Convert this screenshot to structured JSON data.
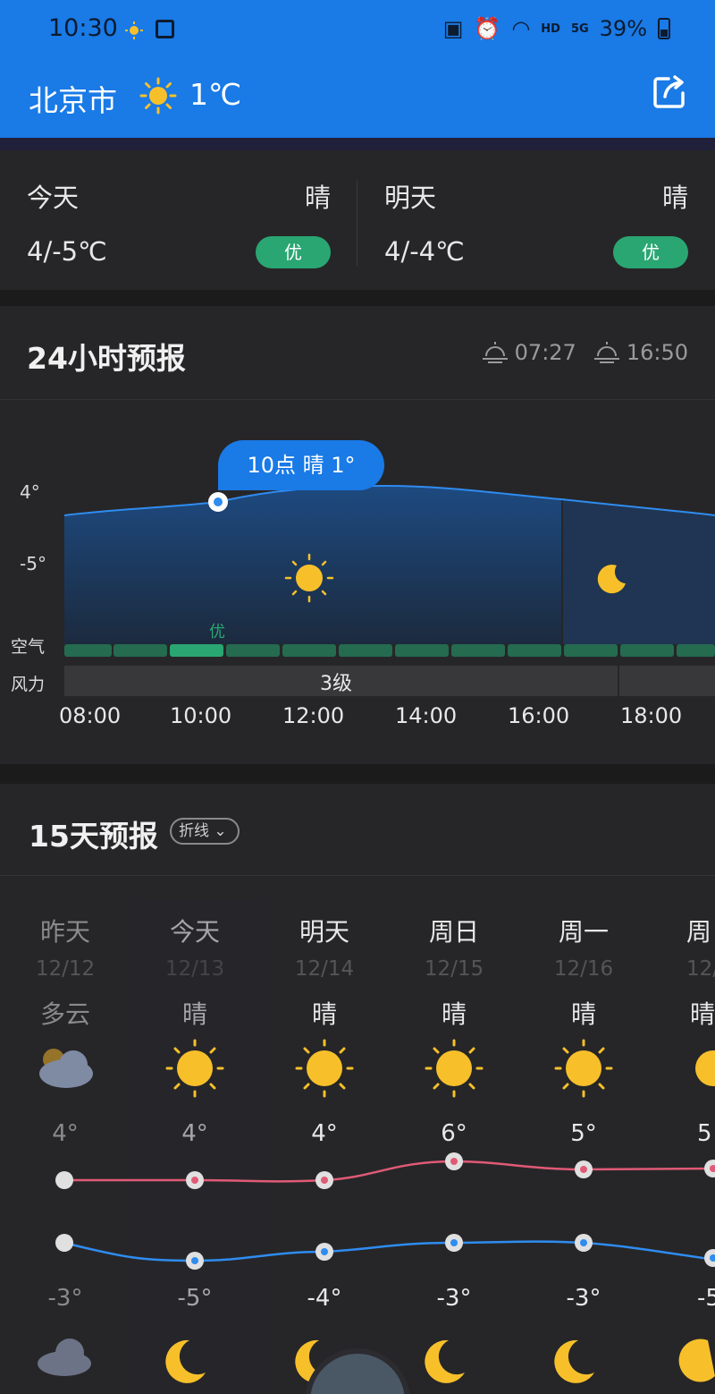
{
  "status_bar": {
    "time": "10:30",
    "network": "5G",
    "hd": "HD",
    "battery": "39%"
  },
  "header": {
    "city": "北京市",
    "current_temp": "1℃"
  },
  "summary": {
    "today": {
      "label": "今天",
      "condition": "晴",
      "range": "4/-5℃",
      "aqi": "优"
    },
    "tomorrow": {
      "label": "明天",
      "condition": "晴",
      "range": "4/-4℃",
      "aqi": "优"
    }
  },
  "hourly": {
    "title": "24小时预报",
    "sunrise": "07:27",
    "sunset": "16:50",
    "tooltip": "10点 晴 1°",
    "y_max_label": "4°",
    "y_min_label": "-5°",
    "air_label": "空气",
    "wind_label": "风力",
    "aqi_label": "优",
    "wind_value": "3级",
    "hours": [
      "08:00",
      "10:00",
      "12:00",
      "14:00",
      "16:00",
      "18:00"
    ]
  },
  "daily": {
    "title": "15天预报",
    "mode": "折线",
    "days": [
      {
        "name": "昨天",
        "date": "12/12",
        "cond": "多云",
        "hi": "4°",
        "lo": "-3°"
      },
      {
        "name": "今天",
        "date": "12/13",
        "cond": "晴",
        "hi": "4°",
        "lo": "-5°"
      },
      {
        "name": "明天",
        "date": "12/14",
        "cond": "晴",
        "hi": "4°",
        "lo": "-4°"
      },
      {
        "name": "周日",
        "date": "12/15",
        "cond": "晴",
        "hi": "6°",
        "lo": "-3°"
      },
      {
        "name": "周一",
        "date": "12/16",
        "cond": "晴",
        "hi": "5°",
        "lo": "-3°"
      },
      {
        "name": "周",
        "date": "12/",
        "cond": "晴",
        "hi": "5",
        "lo": "-5"
      }
    ]
  },
  "colors": {
    "accent": "#1a7ae6",
    "aqi_good": "#2aa672",
    "high_line": "#e05a76",
    "low_line": "#2f8cf0",
    "sun": "#f7c02a"
  }
}
